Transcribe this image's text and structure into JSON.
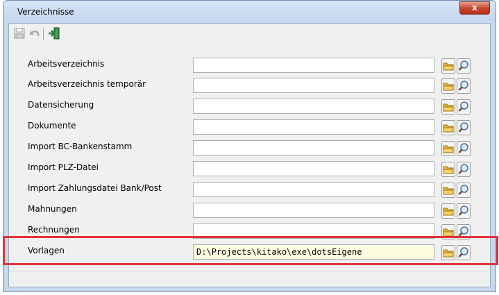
{
  "window": {
    "title": "Verzeichnisse",
    "close_label": "x"
  },
  "toolbar": {
    "icons": [
      "save-icon",
      "undo-icon",
      "exit-icon"
    ]
  },
  "rows": [
    {
      "label": "Arbeitsverzeichnis",
      "value": ""
    },
    {
      "label": "Arbeitsverzeichnis temporär",
      "value": ""
    },
    {
      "label": "Datensicherung",
      "value": ""
    },
    {
      "label": "Dokumente",
      "value": ""
    },
    {
      "label": "Import BC-Bankenstamm",
      "value": ""
    },
    {
      "label": "Import PLZ-Datei",
      "value": ""
    },
    {
      "label": "Import Zahlungsdatei Bank/Post",
      "value": ""
    },
    {
      "label": "Mahnungen",
      "value": ""
    },
    {
      "label": "Rechnungen",
      "value": ""
    },
    {
      "label": "Vorlagen",
      "value": "D:\\Projects\\kitako\\exe\\dotsEigene"
    }
  ],
  "colors": {
    "highlight": "#e0343a",
    "filled_field": "#fffde1"
  }
}
